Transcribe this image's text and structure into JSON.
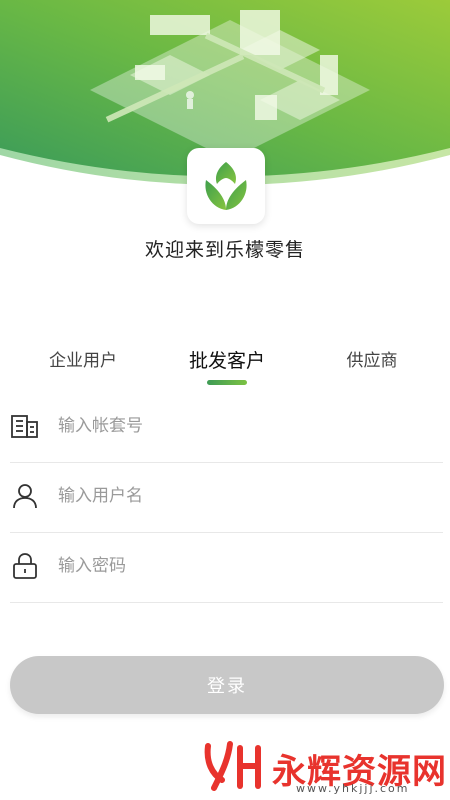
{
  "brand": {
    "welcome": "欢迎来到乐檬零售"
  },
  "tabs": [
    {
      "label": "企业用户",
      "active": false
    },
    {
      "label": "批发客户",
      "active": true
    },
    {
      "label": "供应商",
      "active": false
    }
  ],
  "fields": {
    "account": {
      "placeholder": "输入帐套号",
      "value": "",
      "icon": "building-icon"
    },
    "username": {
      "placeholder": "输入用户名",
      "value": "",
      "icon": "user-icon"
    },
    "password": {
      "placeholder": "输入密码",
      "value": "",
      "icon": "lock-icon"
    }
  },
  "login": {
    "label": "登录"
  },
  "watermark": {
    "text": "永辉资源网",
    "url": "www.yhkjjj.com"
  },
  "colors": {
    "accent": "#5aab4a",
    "button_disabled": "#c8c8c8",
    "watermark": "#e8332d"
  }
}
